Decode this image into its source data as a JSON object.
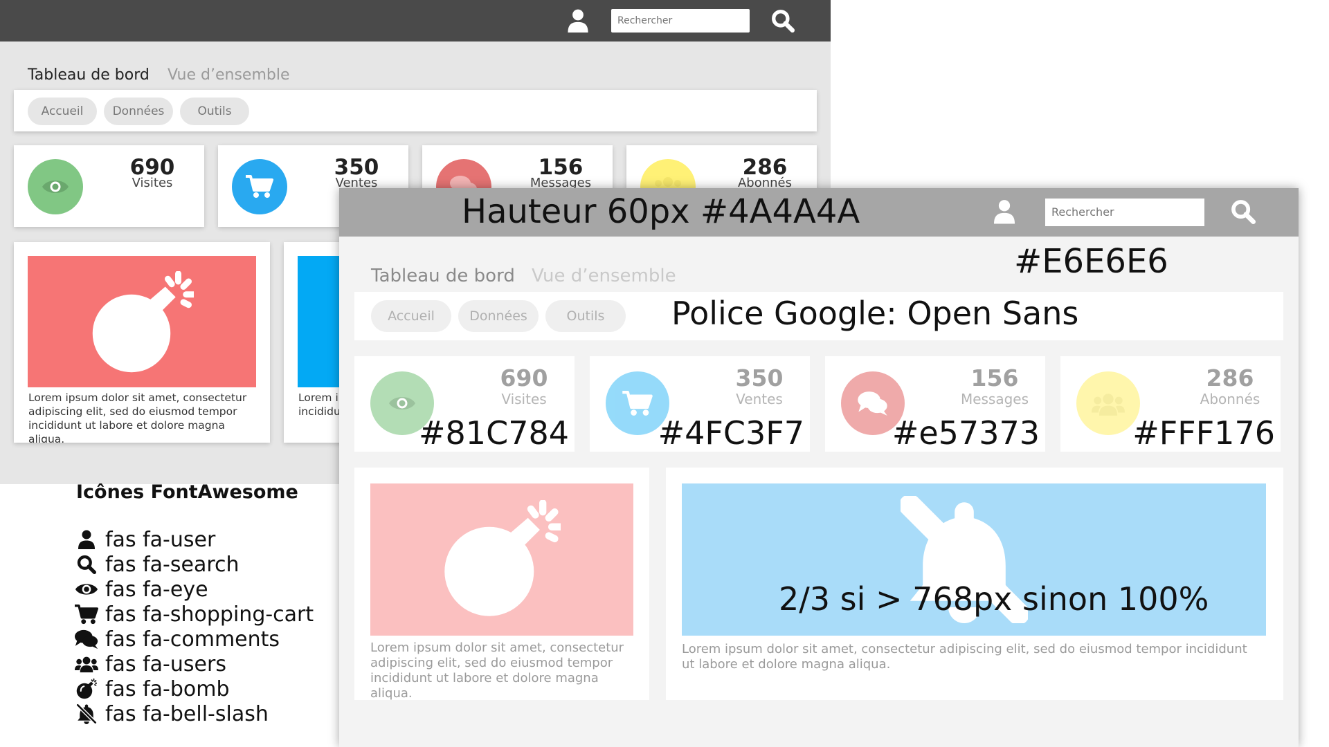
{
  "colors": {
    "bar_dark": "#4A4A4A",
    "bar_light": "#A6A6A6",
    "page_bg": "#E6E6E6",
    "green": "#81C784",
    "blue": "#4FC3F7",
    "red": "#e57373",
    "yellow": "#FFF176"
  },
  "header": {
    "search_placeholder": "Rechercher",
    "user_icon": "user-icon",
    "search_icon": "search-icon"
  },
  "page": {
    "title": "Tableau de bord",
    "subtitle": "Vue d’ensemble"
  },
  "nav": {
    "items": [
      {
        "label": "Accueil"
      },
      {
        "label": "Données"
      },
      {
        "label": "Outils"
      }
    ]
  },
  "stats": [
    {
      "value": "690",
      "label": "Visites",
      "icon": "eye-icon",
      "color": "#81C784"
    },
    {
      "value": "350",
      "label": "Ventes",
      "icon": "shopping-cart-icon",
      "color": "#4FC3F7"
    },
    {
      "value": "156",
      "label": "Messages",
      "icon": "comments-icon",
      "color": "#e57373"
    },
    {
      "value": "286",
      "label": "Abonnés",
      "icon": "users-icon",
      "color": "#FFF176"
    }
  ],
  "cards": {
    "bomb_text": "Lorem ipsum dolor sit amet, consectetur adipiscing elit, sed do eiusmod tempor incididunt ut labore et dolore magna aliqua.",
    "bell_text": "Lorem ipsum dolor sit amet, consectetur adipiscing elit, sed do eiusmod tempor incididunt ut labore et dolore magna aliqua.",
    "bg_blue_text": "Lorem ipsum dolor sit amet, consectetur adipiscing elit, sed do eiusmod tempor incididunt ut labore et dolore magna aliqua."
  },
  "annotations": {
    "bar": "Hauteur 60px #4A4A4A",
    "background": "#E6E6E6",
    "font": "Police Google: Open Sans",
    "width": "2/3 si > 768px sinon 100%",
    "green": "#81C784",
    "blue": "#4FC3F7",
    "red": "#e57373",
    "yellow": "#FFF176"
  },
  "legend": {
    "title": "Icônes FontAwesome",
    "items": [
      {
        "label": "fas fa-user",
        "icon": "user-icon"
      },
      {
        "label": "fas fa-search",
        "icon": "search-icon"
      },
      {
        "label": "fas fa-eye",
        "icon": "eye-icon"
      },
      {
        "label": "fas fa-shopping-cart",
        "icon": "shopping-cart-icon"
      },
      {
        "label": "fas fa-comments",
        "icon": "comments-icon"
      },
      {
        "label": "fas fa-users",
        "icon": "users-icon"
      },
      {
        "label": "fas fa-bomb",
        "icon": "bomb-icon"
      },
      {
        "label": "fas fa-bell-slash",
        "icon": "bell-slash-icon"
      }
    ]
  }
}
